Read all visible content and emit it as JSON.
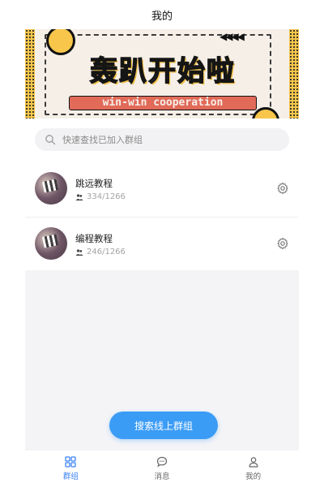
{
  "header": {
    "title": "我的"
  },
  "banner": {
    "headline": "轰趴开始啦",
    "subline": "win-win cooperation",
    "arrows": "◀◀◀◀"
  },
  "search": {
    "placeholder": "快速查找已加入群组"
  },
  "groups": [
    {
      "name": "跳远教程",
      "members": "334/1266"
    },
    {
      "name": "编程教程",
      "members": "246/1266"
    }
  ],
  "cta": {
    "label": "搜索线上群组"
  },
  "tabs": [
    {
      "label": "群组",
      "icon": "grid-icon",
      "active": true
    },
    {
      "label": "消息",
      "icon": "chat-icon",
      "active": false
    },
    {
      "label": "我的",
      "icon": "user-icon",
      "active": false
    }
  ],
  "colors": {
    "accent": "#3b9cf6",
    "active_tab": "#3b82f6"
  }
}
